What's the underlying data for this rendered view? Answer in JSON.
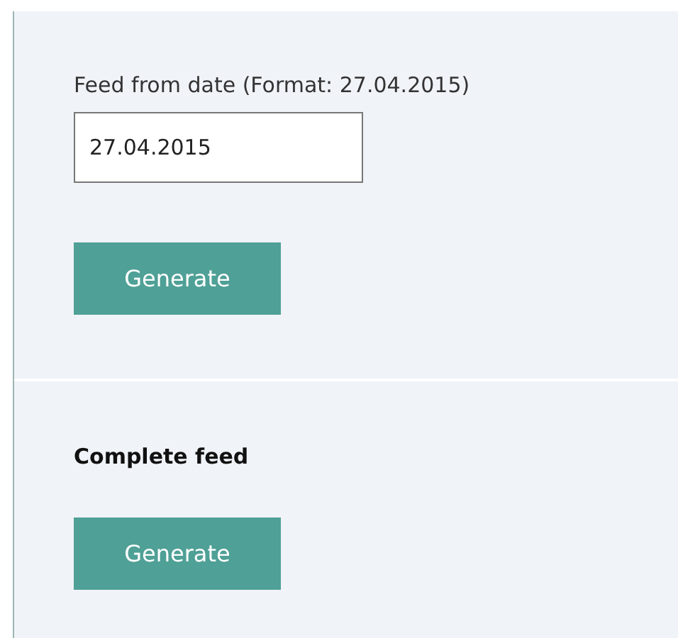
{
  "sections": [
    {
      "kind": "date",
      "label": "Feed from date (Format: 27.04.2015)",
      "value": "27.04.2015",
      "button": "Generate"
    },
    {
      "kind": "complete",
      "heading": "Complete feed",
      "button": "Generate"
    }
  ]
}
